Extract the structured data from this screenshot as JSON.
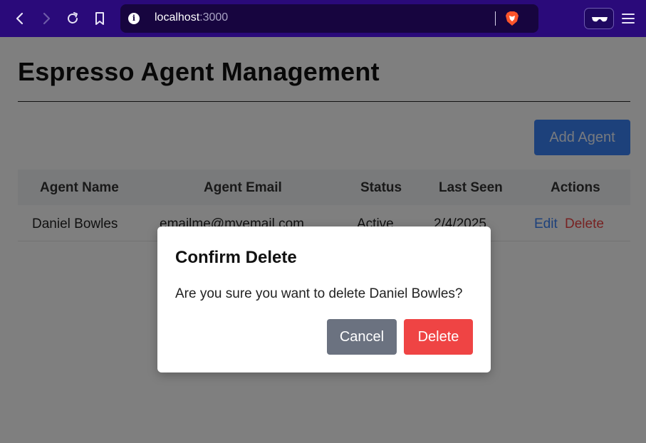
{
  "browser": {
    "url_host": "localhost",
    "url_port": ":3000",
    "icons": [
      "back-icon",
      "forward-icon",
      "reload-icon",
      "bookmark-icon",
      "site-info-icon",
      "brave-shields-icon",
      "extension-glasses-icon",
      "menu-icon"
    ],
    "colors": {
      "chrome": "#2a0a7a",
      "address_bar": "#17053f"
    }
  },
  "page": {
    "title": "Espresso Agent Management",
    "add_button_label": "Add Agent",
    "table": {
      "headers": [
        "Agent Name",
        "Agent Email",
        "Status",
        "Last Seen",
        "Actions"
      ],
      "rows": [
        {
          "name": "Daniel Bowles",
          "email": "emailme@myemail.com",
          "status": "Active",
          "last_seen": "2/4/2025",
          "edit_label": "Edit",
          "delete_label": "Delete"
        }
      ]
    }
  },
  "modal": {
    "title": "Confirm Delete",
    "message": "Are you sure you want to delete Daniel Bowles?",
    "cancel_label": "Cancel",
    "delete_label": "Delete"
  },
  "colors": {
    "primary": "#3b82f6",
    "danger": "#ef4444",
    "secondary": "#6b7280"
  }
}
